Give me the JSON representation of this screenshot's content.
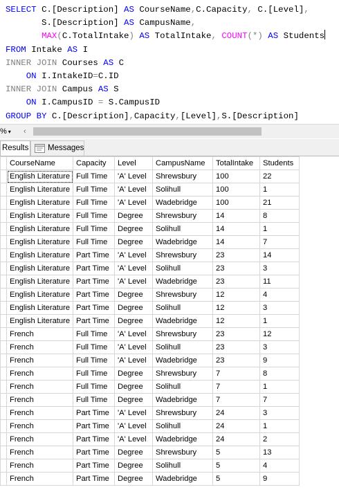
{
  "query": {
    "lines": [
      [
        {
          "t": "SELECT ",
          "c": "kw"
        },
        {
          "t": "C.[Description] ",
          "c": ""
        },
        {
          "t": "AS ",
          "c": "kw"
        },
        {
          "t": "CourseName",
          "c": ""
        },
        {
          "t": ",",
          "c": "gr"
        },
        {
          "t": "C.Capacity",
          "c": ""
        },
        {
          "t": ", ",
          "c": "gr"
        },
        {
          "t": "C.[Level]",
          "c": ""
        },
        {
          "t": ",",
          "c": "gr"
        }
      ],
      [
        {
          "t": "       S.[Description] ",
          "c": ""
        },
        {
          "t": "AS ",
          "c": "kw"
        },
        {
          "t": "CampusName",
          "c": ""
        },
        {
          "t": ",",
          "c": "gr"
        }
      ],
      [
        {
          "t": "       ",
          "c": ""
        },
        {
          "t": "MAX",
          "c": "fn"
        },
        {
          "t": "(",
          "c": "gr"
        },
        {
          "t": "C.TotalIntake",
          "c": ""
        },
        {
          "t": ") ",
          "c": "gr"
        },
        {
          "t": "AS ",
          "c": "kw"
        },
        {
          "t": "TotalIntake",
          "c": ""
        },
        {
          "t": ", ",
          "c": "gr"
        },
        {
          "t": "COUNT",
          "c": "fn"
        },
        {
          "t": "(*) ",
          "c": "gr"
        },
        {
          "t": "AS ",
          "c": "kw"
        },
        {
          "t": "Students",
          "c": ""
        }
      ],
      [
        {
          "t": "FROM ",
          "c": "kw"
        },
        {
          "t": "Intake ",
          "c": ""
        },
        {
          "t": "AS ",
          "c": "kw"
        },
        {
          "t": "I",
          "c": ""
        }
      ],
      [
        {
          "t": "INNER JOIN ",
          "c": "gr"
        },
        {
          "t": "Courses ",
          "c": ""
        },
        {
          "t": "AS ",
          "c": "kw"
        },
        {
          "t": "C",
          "c": ""
        }
      ],
      [
        {
          "t": "    ",
          "c": ""
        },
        {
          "t": "ON ",
          "c": "kw"
        },
        {
          "t": "I.IntakeID",
          "c": ""
        },
        {
          "t": "=",
          "c": "gr"
        },
        {
          "t": "C.ID",
          "c": ""
        }
      ],
      [
        {
          "t": "INNER JOIN ",
          "c": "gr"
        },
        {
          "t": "Campus ",
          "c": ""
        },
        {
          "t": "AS ",
          "c": "kw"
        },
        {
          "t": "S",
          "c": ""
        }
      ],
      [
        {
          "t": "    ",
          "c": ""
        },
        {
          "t": "ON ",
          "c": "kw"
        },
        {
          "t": "I.CampusID ",
          "c": ""
        },
        {
          "t": "= ",
          "c": "gr"
        },
        {
          "t": "S.CampusID",
          "c": ""
        }
      ],
      [
        {
          "t": "GROUP BY ",
          "c": "kw"
        },
        {
          "t": "C.[Description]",
          "c": ""
        },
        {
          "t": ",",
          "c": "gr"
        },
        {
          "t": "Capacity",
          "c": ""
        },
        {
          "t": ",",
          "c": "gr"
        },
        {
          "t": "[Level]",
          "c": ""
        },
        {
          "t": ",",
          "c": "gr"
        },
        {
          "t": "S.[Description]",
          "c": ""
        }
      ]
    ]
  },
  "zoom": {
    "label": "%"
  },
  "tabs": {
    "results": "Results",
    "messages": "Messages"
  },
  "grid": {
    "columns": [
      "CourseName",
      "Capacity",
      "Level",
      "CampusName",
      "TotalIntake",
      "Students"
    ],
    "rows": [
      [
        "English Literature",
        "Full Time",
        "'A' Level",
        "Shrewsbury",
        "100",
        "22"
      ],
      [
        "English Literature",
        "Full Time",
        "'A' Level",
        "Solihull",
        "100",
        "1"
      ],
      [
        "English Literature",
        "Full Time",
        "'A' Level",
        "Wadebridge",
        "100",
        "21"
      ],
      [
        "English Literature",
        "Full Time",
        "Degree",
        "Shrewsbury",
        "14",
        "8"
      ],
      [
        "English Literature",
        "Full Time",
        "Degree",
        "Solihull",
        "14",
        "1"
      ],
      [
        "English Literature",
        "Full Time",
        "Degree",
        "Wadebridge",
        "14",
        "7"
      ],
      [
        "English Literature",
        "Part Time",
        "'A' Level",
        "Shrewsbury",
        "23",
        "14"
      ],
      [
        "English Literature",
        "Part Time",
        "'A' Level",
        "Solihull",
        "23",
        "3"
      ],
      [
        "English Literature",
        "Part Time",
        "'A' Level",
        "Wadebridge",
        "23",
        "11"
      ],
      [
        "English Literature",
        "Part Time",
        "Degree",
        "Shrewsbury",
        "12",
        "4"
      ],
      [
        "English Literature",
        "Part Time",
        "Degree",
        "Solihull",
        "12",
        "3"
      ],
      [
        "English Literature",
        "Part Time",
        "Degree",
        "Wadebridge",
        "12",
        "1"
      ],
      [
        "French",
        "Full Time",
        "'A' Level",
        "Shrewsbury",
        "23",
        "12"
      ],
      [
        "French",
        "Full Time",
        "'A' Level",
        "Solihull",
        "23",
        "3"
      ],
      [
        "French",
        "Full Time",
        "'A' Level",
        "Wadebridge",
        "23",
        "9"
      ],
      [
        "French",
        "Full Time",
        "Degree",
        "Shrewsbury",
        "7",
        "8"
      ],
      [
        "French",
        "Full Time",
        "Degree",
        "Solihull",
        "7",
        "1"
      ],
      [
        "French",
        "Full Time",
        "Degree",
        "Wadebridge",
        "7",
        "7"
      ],
      [
        "French",
        "Part Time",
        "'A' Level",
        "Shrewsbury",
        "24",
        "3"
      ],
      [
        "French",
        "Part Time",
        "'A' Level",
        "Solihull",
        "24",
        "1"
      ],
      [
        "French",
        "Part Time",
        "'A' Level",
        "Wadebridge",
        "24",
        "2"
      ],
      [
        "French",
        "Part Time",
        "Degree",
        "Shrewsbury",
        "5",
        "13"
      ],
      [
        "French",
        "Part Time",
        "Degree",
        "Solihull",
        "5",
        "4"
      ],
      [
        "French",
        "Part Time",
        "Degree",
        "Wadebridge",
        "5",
        "9"
      ]
    ]
  }
}
